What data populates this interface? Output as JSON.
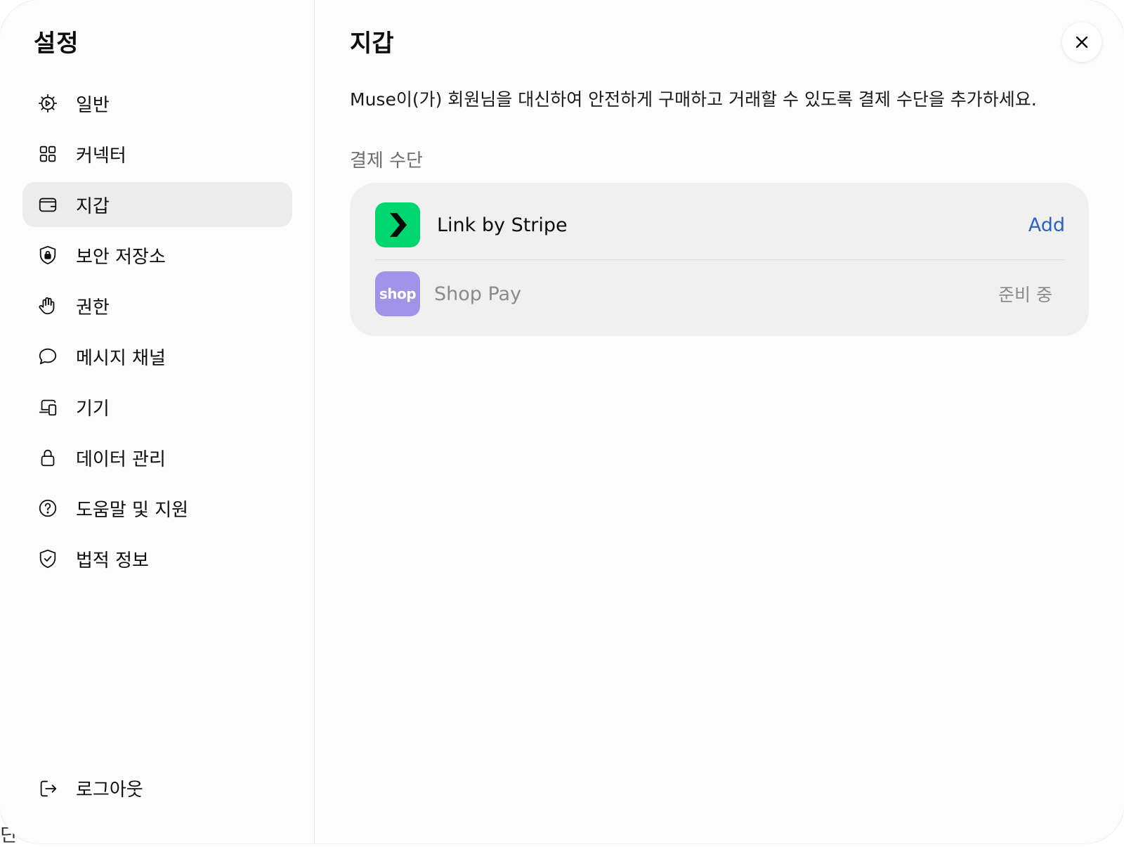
{
  "backdrop": {
    "text": "딘 기능"
  },
  "sidebar": {
    "title": "설정",
    "items": [
      {
        "label": "일반",
        "icon": "gear-icon"
      },
      {
        "label": "커넥터",
        "icon": "grid-icon"
      },
      {
        "label": "지갑",
        "icon": "wallet-icon",
        "active": true
      },
      {
        "label": "보안 저장소",
        "icon": "shield-lock-icon"
      },
      {
        "label": "권한",
        "icon": "hand-icon"
      },
      {
        "label": "메시지 채널",
        "icon": "chat-bubble-icon"
      },
      {
        "label": "기기",
        "icon": "devices-icon"
      },
      {
        "label": "데이터 관리",
        "icon": "lock-icon"
      },
      {
        "label": "도움말 및 지원",
        "icon": "help-circle-icon"
      },
      {
        "label": "법적 정보",
        "icon": "shield-check-icon"
      }
    ],
    "logout": {
      "label": "로그아웃",
      "icon": "logout-icon"
    }
  },
  "main": {
    "title": "지갑",
    "description": "Muse이(가) 회원님을 대신하여 안전하게 구매하고 거래할 수 있도록 결제 수단을 추가하세요.",
    "section_label": "결제 수단",
    "methods": [
      {
        "name": "Link by Stripe",
        "action": "Add",
        "logo": "link-stripe-logo",
        "logo_color": "#00d66f"
      },
      {
        "name": "Shop Pay",
        "status": "준비 중",
        "logo": "shop-pay-logo",
        "logo_text": "shop",
        "logo_color": "#a193e8"
      }
    ],
    "close_icon": "close-icon"
  },
  "colors": {
    "accent_link": "#2a62c9",
    "active_nav_bg": "#ececec",
    "card_bg": "#f0f0f0"
  }
}
